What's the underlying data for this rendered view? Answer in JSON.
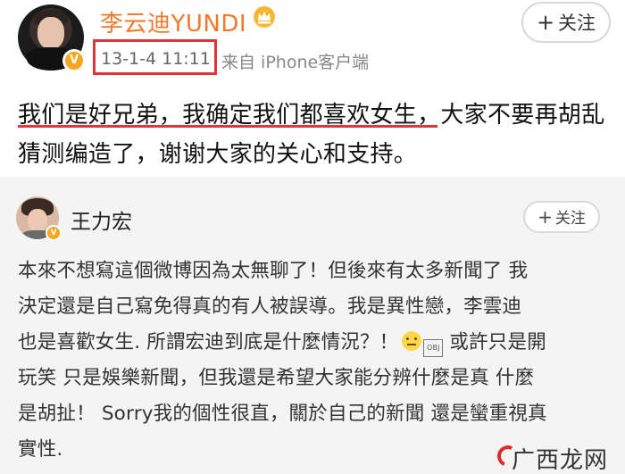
{
  "post": {
    "username": "李云迪YUNDI",
    "time": "13-1-4 11:11",
    "source": "来自 iPhone客户端",
    "follow_label": "关注",
    "follow_plus": "+",
    "text_line1": "我们是好兄弟，我确定我们都喜欢女生，大家不要再胡乱",
    "text_line2": "猜测编造了，谢谢大家的关心和支持。"
  },
  "repost": {
    "username": "王力宏",
    "follow_label": "关注",
    "follow_plus": "+",
    "line1": "本來不想寫這個微博因為太無聊了！但後來有太多新聞了 我",
    "line2": "決定還是自己寫免得真的有人被誤導。我是異性戀，李雲迪",
    "line3": "也是喜歡女生. 所謂宏迪到底是什麼情況？！",
    "line3_tail": " 或許只是開",
    "line4": "玩笑 只是娛樂新聞，但我還是希望大家能分辨什麼是真 什麼",
    "line5": "是胡扯！ Sorry我的個性很直，關於自己的新聞 還是蠻重視真",
    "line6": "實性.",
    "obj_label": "OBJ"
  },
  "icons": {
    "verified": "V",
    "emoji": "smile-icon",
    "crown": "crown-icon"
  },
  "watermark": "广西龙网",
  "colors": {
    "username_orange": "#f0792b",
    "highlight_red": "#e5333b",
    "verified_gold": "#f5a623"
  }
}
